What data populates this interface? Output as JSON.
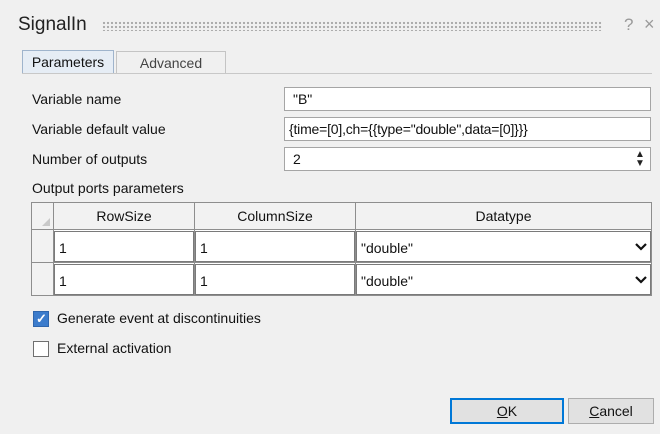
{
  "window": {
    "title": "SignalIn",
    "help_glyph": "?",
    "close_glyph": "×"
  },
  "tabs": [
    {
      "label": "Parameters",
      "active": true
    },
    {
      "label": "Advanced",
      "active": false
    }
  ],
  "fields": {
    "variable_name": {
      "label": "Variable name",
      "value": "\"B\""
    },
    "default_value": {
      "label": "Variable default value",
      "value": "{time=[0],ch={{type=\"double\",data=[0]}}}"
    },
    "num_outputs": {
      "label": "Number of outputs",
      "value": "2"
    }
  },
  "ports_table": {
    "label": "Output ports parameters",
    "columns": [
      "RowSize",
      "ColumnSize",
      "Datatype"
    ],
    "rows": [
      {
        "rowsize": "1",
        "columnsize": "1",
        "datatype": "\"double\""
      },
      {
        "rowsize": "1",
        "columnsize": "1",
        "datatype": "\"double\""
      }
    ]
  },
  "checkboxes": [
    {
      "label": "Generate event at discontinuities",
      "checked": true
    },
    {
      "label": "External activation",
      "checked": false
    }
  ],
  "buttons": {
    "ok": {
      "mnemonic": "O",
      "rest": "K"
    },
    "cancel": {
      "mnemonic": "C",
      "rest": "ancel"
    }
  },
  "icons": {
    "spin": "spin-up-down-icon",
    "dropdown": "chevron-down-icon",
    "check": "checkmark-icon"
  },
  "colors": {
    "accent": "#3c7ccc",
    "active_tab": "#e6edf5",
    "default_button_border": "#0078d7"
  }
}
